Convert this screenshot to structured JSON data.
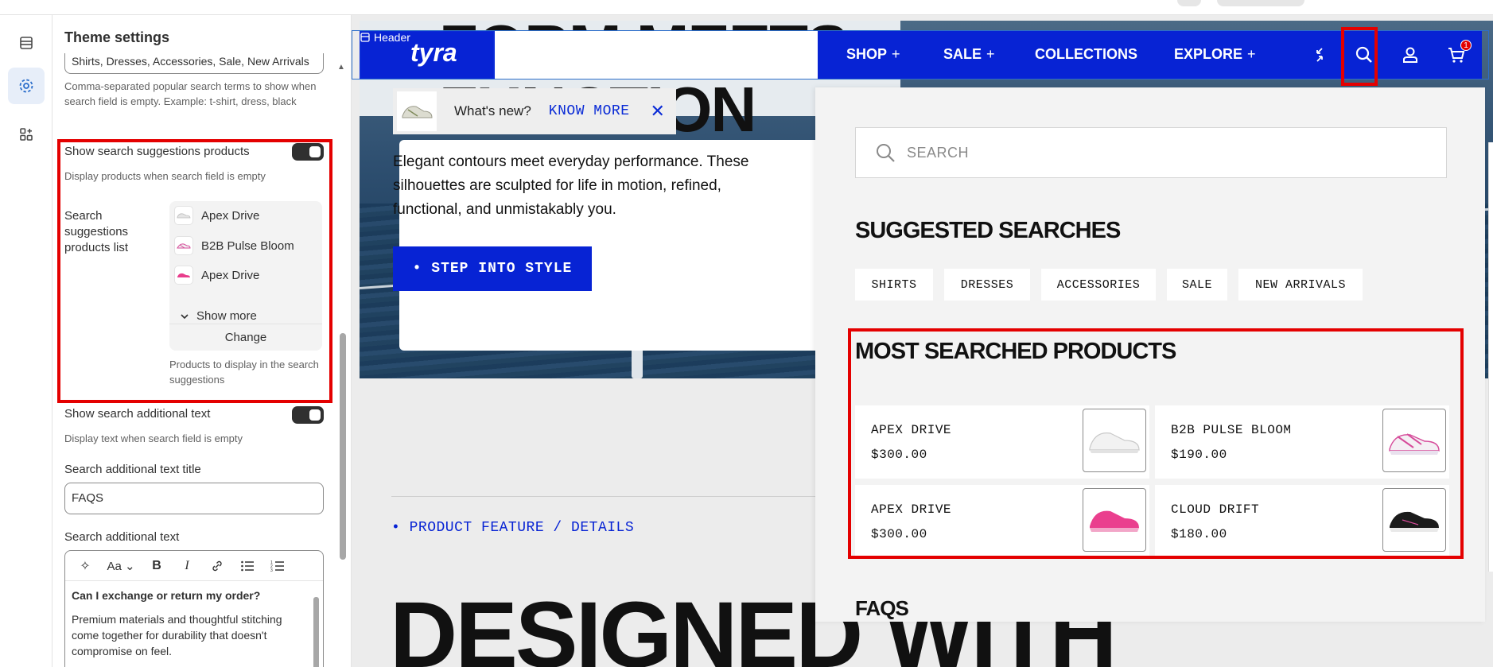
{
  "sidebar_panel": {
    "title": "Theme settings",
    "popular_terms_value": "Shirts, Dresses, Accessories, Sale, New Arrivals",
    "popular_terms_help": "Comma-separated popular search terms to show when search field is empty. Example: t-shirt, dress, black",
    "show_suggestions_label": "Show search suggestions products",
    "show_suggestions_help": "Display products when search field is empty",
    "suggestions_list_label": "Search suggestions products list",
    "suggestions_products": [
      {
        "name": "Apex Drive",
        "icon": "white-sneaker-icon"
      },
      {
        "name": "B2B Pulse Bloom",
        "icon": "pink-white-sneaker-icon"
      },
      {
        "name": "Apex Drive",
        "icon": "pink-sneaker-icon"
      }
    ],
    "show_more_label": "Show more",
    "change_label": "Change",
    "suggestions_list_help": "Products to display in the search suggestions",
    "show_additional_label": "Show search additional text",
    "show_additional_help": "Display text when search field is empty",
    "additional_title_label": "Search additional text title",
    "additional_title_value": "FAQS",
    "additional_text_label": "Search additional text",
    "rte_question": "Can I exchange or return my order?",
    "rte_answer": "Premium materials and thoughtful stitching come together for durability that doesn't compromise on feel.",
    "toggles": {
      "show_suggestions": true,
      "show_additional": true
    }
  },
  "preview": {
    "header_tag": "Header",
    "logo": "tyra",
    "nav": [
      {
        "label": "SHOP",
        "suffix": "+"
      },
      {
        "label": "SALE",
        "suffix": "+"
      },
      {
        "label": "COLLECTIONS",
        "suffix": ""
      },
      {
        "label": "EXPLORE",
        "suffix": "+"
      }
    ],
    "cart_count": "1",
    "hero_title_line1": "FORM MEETS",
    "hero_title_line2": "FUNCTION",
    "whats_new": "What's new?",
    "know_more": "KNOW MORE",
    "hero_description": "Elegant contours meet everyday performance. These silhouettes are sculpted for life in motion, refined, functional, and unmistakably you.",
    "cta": "• STEP INTO STYLE",
    "feature_link": "• PRODUCT FEATURE / DETAILS",
    "big_title": "DESIGNED WITH"
  },
  "search_drawer": {
    "placeholder": "SEARCH",
    "suggested_title": "SUGGESTED SEARCHES",
    "chips": [
      "SHIRTS",
      "DRESSES",
      "ACCESSORIES",
      "SALE",
      "NEW ARRIVALS"
    ],
    "most_searched_title": "MOST SEARCHED PRODUCTS",
    "products": [
      {
        "name": "APEX DRIVE",
        "price": "$300.00",
        "image": "white-sneaker-icon"
      },
      {
        "name": "B2B PULSE BLOOM",
        "price": "$190.00",
        "image": "pink-white-sneaker-icon"
      },
      {
        "name": "APEX DRIVE",
        "price": "$300.00",
        "image": "pink-sneaker-icon"
      },
      {
        "name": "CLOUD DRIFT",
        "price": "$180.00",
        "image": "black-sneaker-icon"
      }
    ],
    "faqs_title": "FAQS"
  },
  "colors": {
    "brand_blue": "#0723d4",
    "highlight_red": "#e40000"
  }
}
